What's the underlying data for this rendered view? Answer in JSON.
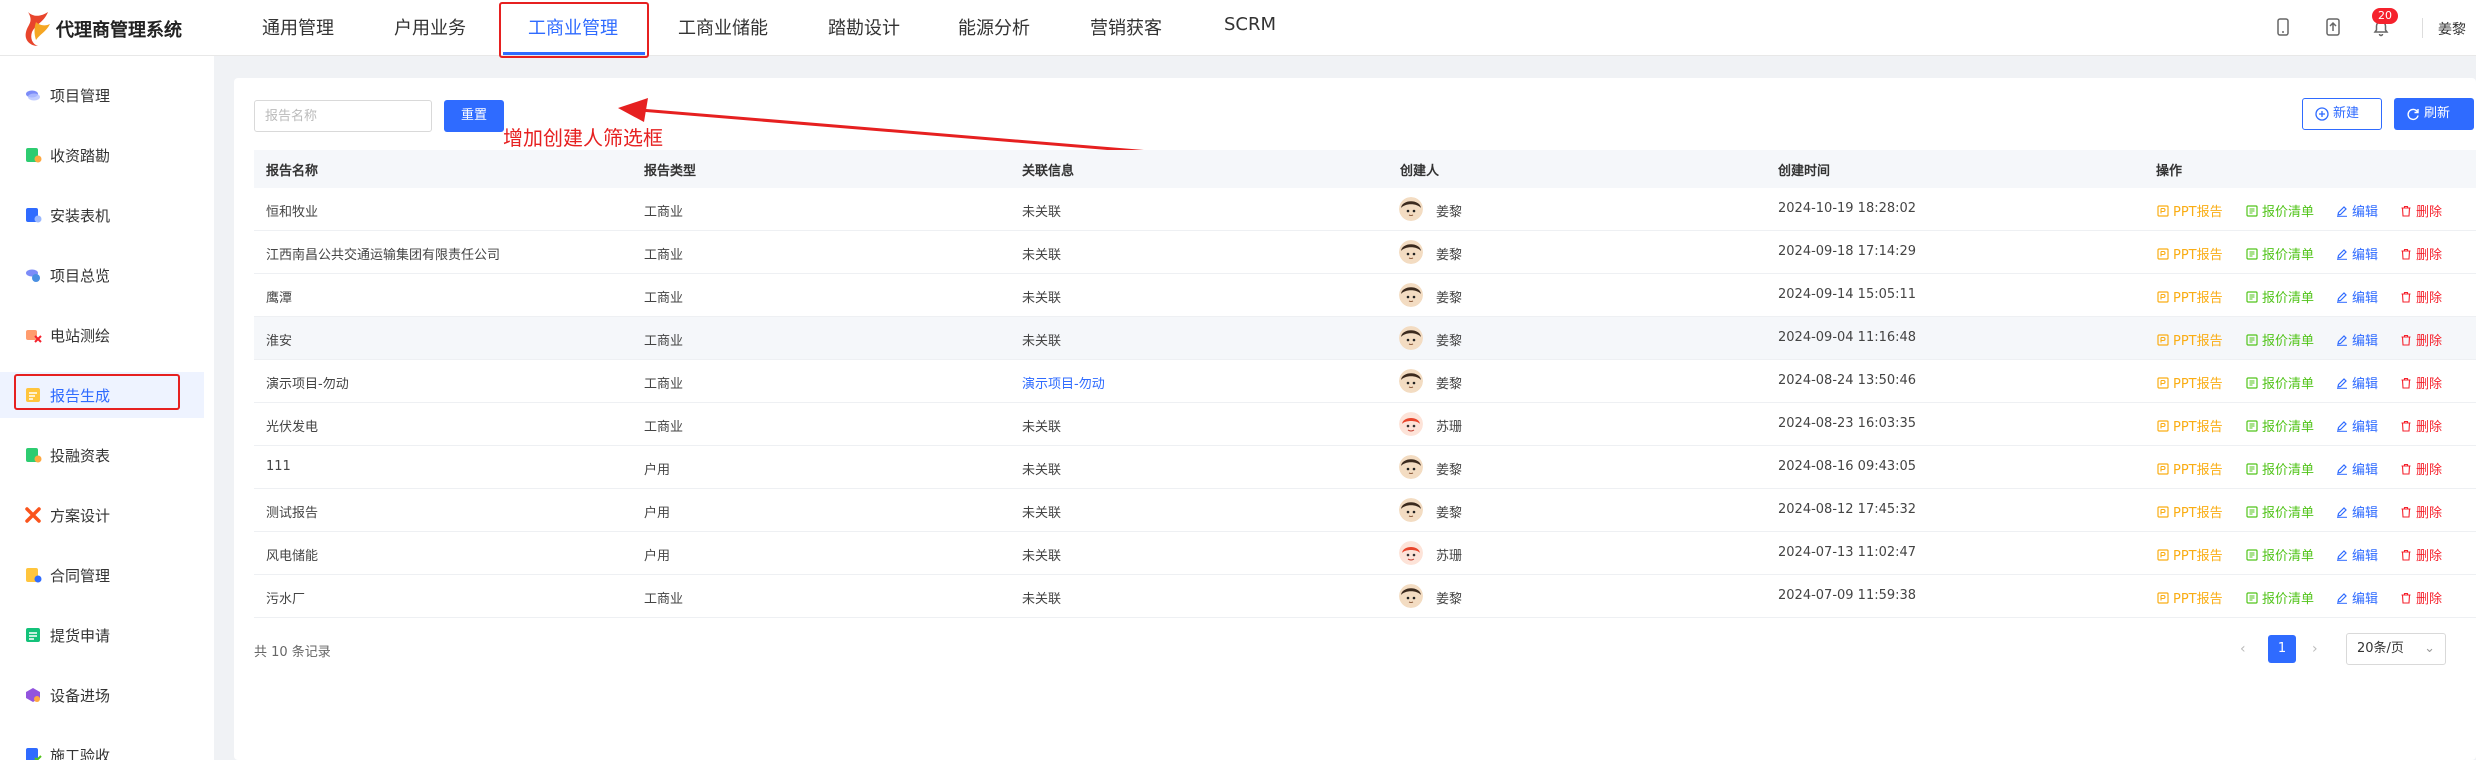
{
  "app": {
    "title": "代理商管理系统"
  },
  "top_nav": [
    {
      "label": "通用管理"
    },
    {
      "label": "户用业务"
    },
    {
      "label": "工商业管理"
    },
    {
      "label": "工商业储能"
    },
    {
      "label": "踏勘设计"
    },
    {
      "label": "能源分析"
    },
    {
      "label": "营销获客"
    },
    {
      "label": "SCRM"
    }
  ],
  "header": {
    "notification_count": "20",
    "user_name": "姜黎",
    "icons": [
      "mobile-icon",
      "upload-icon",
      "bell-icon"
    ]
  },
  "sidebar": {
    "items": [
      {
        "label": "项目管理",
        "icon": "project-icon"
      },
      {
        "label": "收资踏勘",
        "icon": "survey-icon"
      },
      {
        "label": "安装表机",
        "icon": "install-icon"
      },
      {
        "label": "项目总览",
        "icon": "overview-icon"
      },
      {
        "label": "电站测绘",
        "icon": "mapping-icon"
      },
      {
        "label": "报告生成",
        "icon": "report-icon"
      },
      {
        "label": "投融资表",
        "icon": "finance-icon"
      },
      {
        "label": "方案设计",
        "icon": "design-icon"
      },
      {
        "label": "合同管理",
        "icon": "contract-icon"
      },
      {
        "label": "提货申请",
        "icon": "pickup-icon"
      },
      {
        "label": "设备进场",
        "icon": "equipment-icon"
      },
      {
        "label": "施工验收",
        "icon": "acceptance-icon"
      }
    ]
  },
  "toolbar": {
    "search_placeholder": "报告名称",
    "reset_label": "重置",
    "new_label": "新建",
    "refresh_label": "刷新"
  },
  "annotation": {
    "text": "增加创建人筛选框"
  },
  "table": {
    "columns": [
      "报告名称",
      "报告类型",
      "关联信息",
      "创建人",
      "创建时间",
      "操作"
    ],
    "rows": [
      {
        "name": "恒和牧业",
        "type": "工商业",
        "link": "未关联",
        "creator": "姜黎",
        "time": "2024-10-19 18:28:02"
      },
      {
        "name": "江西南昌公共交通运输集团有限责任公司",
        "type": "工商业",
        "link": "未关联",
        "creator": "姜黎",
        "time": "2024-09-18 17:14:29"
      },
      {
        "name": "鹰潭",
        "type": "工商业",
        "link": "未关联",
        "creator": "姜黎",
        "time": "2024-09-14 15:05:11"
      },
      {
        "name": "淮安",
        "type": "工商业",
        "link": "未关联",
        "creator": "姜黎",
        "time": "2024-09-04 11:16:48"
      },
      {
        "name": "演示项目-勿动",
        "type": "工商业",
        "link": "演示项目-勿动",
        "creator": "姜黎",
        "time": "2024-08-24 13:50:46"
      },
      {
        "name": "光伏发电",
        "type": "工商业",
        "link": "未关联",
        "creator": "苏珊",
        "time": "2024-08-23 16:03:35"
      },
      {
        "name": "111",
        "type": "户用",
        "link": "未关联",
        "creator": "姜黎",
        "time": "2024-08-16 09:43:05"
      },
      {
        "name": "测试报告",
        "type": "户用",
        "link": "未关联",
        "creator": "姜黎",
        "time": "2024-08-12 17:45:32"
      },
      {
        "name": "风电储能",
        "type": "户用",
        "link": "未关联",
        "creator": "苏珊",
        "time": "2024-07-13 11:02:47"
      },
      {
        "name": "污水厂",
        "type": "工商业",
        "link": "未关联",
        "creator": "姜黎",
        "time": "2024-07-09 11:59:38"
      }
    ],
    "actions": {
      "ppt": "PPT报告",
      "quote": "报价清单",
      "edit": "编辑",
      "delete": "删除"
    }
  },
  "pagination": {
    "total_text": "共 10 条记录",
    "current_page": "1",
    "page_size": "20条/页"
  },
  "colors": {
    "accent": "#2f6bff",
    "annotation_red": "#e62020",
    "ppt": "#faad14",
    "quote": "#52c41a",
    "delete": "#f5222d"
  }
}
